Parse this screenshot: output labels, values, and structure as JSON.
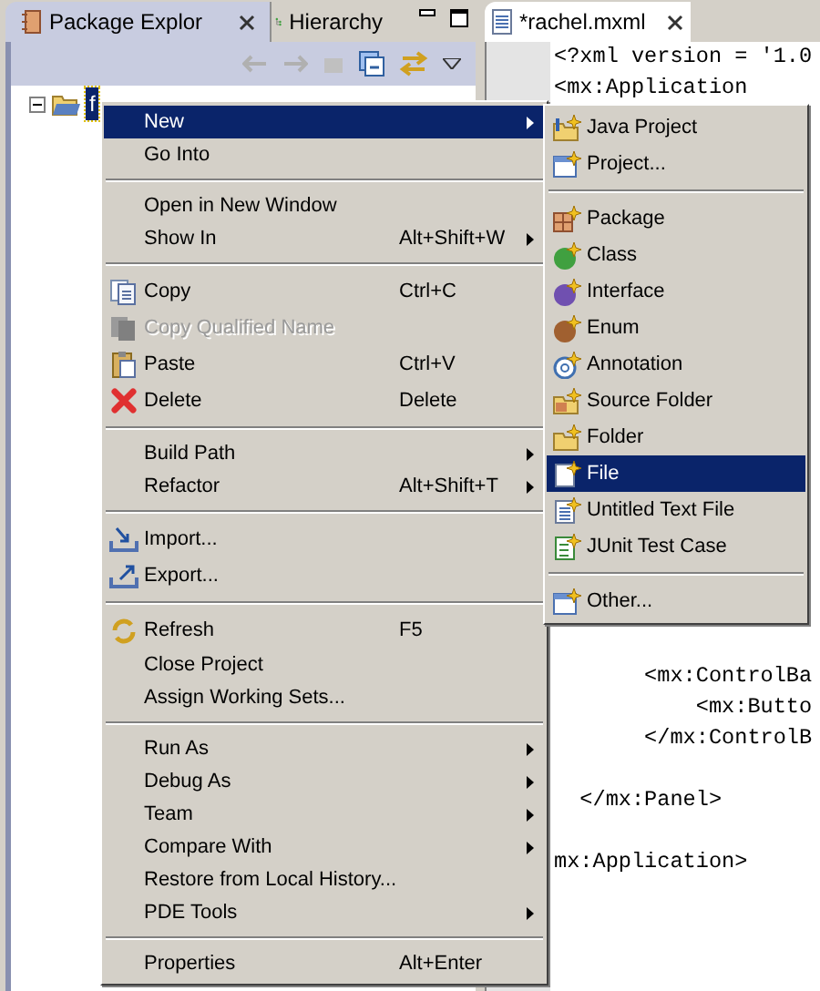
{
  "left_view": {
    "tabs": [
      {
        "label": "Package Explor",
        "selected": true
      },
      {
        "label": "Hierarchy",
        "selected": false
      }
    ],
    "tree": [
      {
        "label": "f",
        "expanded": true,
        "selected": true
      }
    ]
  },
  "editor": {
    "tab": {
      "label": "*rachel.mxml"
    },
    "lines": [
      {
        "kind": "code",
        "text": "<?xml version = '1.0"
      },
      {
        "kind": "code",
        "text": "<mx:Application"
      },
      {
        "kind": "blank"
      },
      {
        "kind": "blank"
      },
      {
        "kind": "blank"
      },
      {
        "kind": "blank"
      },
      {
        "kind": "blank"
      },
      {
        "kind": "blank"
      },
      {
        "kind": "blank"
      },
      {
        "kind": "blank"
      },
      {
        "kind": "blank"
      },
      {
        "kind": "blank"
      },
      {
        "kind": "blank"
      },
      {
        "kind": "blank"
      },
      {
        "kind": "blank"
      },
      {
        "kind": "blank"
      },
      {
        "kind": "blank"
      },
      {
        "kind": "blank"
      },
      {
        "kind": "blank"
      },
      {
        "kind": "blank"
      },
      {
        "kind": "code",
        "text": "       <mx:ControlBa"
      },
      {
        "kind": "code",
        "text": "           <mx:Butto"
      },
      {
        "kind": "code",
        "text": "       </mx:ControlB"
      },
      {
        "kind": "blank"
      },
      {
        "kind": "code",
        "text": "  </mx:Panel>"
      },
      {
        "kind": "blank"
      },
      {
        "kind": "code",
        "text": "mx:Application>"
      }
    ]
  },
  "context_menu": {
    "items": [
      {
        "kind": "item",
        "label": "New",
        "submenu": true,
        "selected": true,
        "disabled": false
      },
      {
        "kind": "item",
        "label": "Go Into",
        "selected": false,
        "disabled": false
      },
      {
        "kind": "separator"
      },
      {
        "kind": "item",
        "label": "Open in New Window",
        "selected": false,
        "disabled": false
      },
      {
        "kind": "item",
        "label": "Show In",
        "shortcut": "Alt+Shift+W",
        "submenu": true,
        "selected": false,
        "disabled": false
      },
      {
        "kind": "separator"
      },
      {
        "kind": "item",
        "label": "Copy",
        "shortcut": "Ctrl+C",
        "selected": false,
        "disabled": false
      },
      {
        "kind": "item",
        "label": "Copy Qualified Name",
        "selected": false,
        "disabled": true
      },
      {
        "kind": "item",
        "label": "Paste",
        "shortcut": "Ctrl+V",
        "selected": false,
        "disabled": false
      },
      {
        "kind": "item",
        "label": "Delete",
        "shortcut": "Delete",
        "selected": false,
        "disabled": false
      },
      {
        "kind": "separator"
      },
      {
        "kind": "item",
        "label": "Build Path",
        "submenu": true,
        "selected": false,
        "disabled": false
      },
      {
        "kind": "item",
        "label": "Refactor",
        "shortcut": "Alt+Shift+T",
        "submenu": true,
        "selected": false,
        "disabled": false
      },
      {
        "kind": "separator"
      },
      {
        "kind": "item",
        "label": "Import...",
        "selected": false,
        "disabled": false
      },
      {
        "kind": "item",
        "label": "Export...",
        "selected": false,
        "disabled": false
      },
      {
        "kind": "separator"
      },
      {
        "kind": "item",
        "label": "Refresh",
        "shortcut": "F5",
        "selected": false,
        "disabled": false
      },
      {
        "kind": "item",
        "label": "Close Project",
        "selected": false,
        "disabled": false
      },
      {
        "kind": "item",
        "label": "Assign Working Sets...",
        "selected": false,
        "disabled": false
      },
      {
        "kind": "separator"
      },
      {
        "kind": "item",
        "label": "Run As",
        "submenu": true,
        "selected": false,
        "disabled": false
      },
      {
        "kind": "item",
        "label": "Debug As",
        "submenu": true,
        "selected": false,
        "disabled": false
      },
      {
        "kind": "item",
        "label": "Team",
        "submenu": true,
        "selected": false,
        "disabled": false
      },
      {
        "kind": "item",
        "label": "Compare With",
        "submenu": true,
        "selected": false,
        "disabled": false
      },
      {
        "kind": "item",
        "label": "Restore from Local History...",
        "selected": false,
        "disabled": false
      },
      {
        "kind": "item",
        "label": "PDE Tools",
        "submenu": true,
        "selected": false,
        "disabled": false
      },
      {
        "kind": "separator"
      },
      {
        "kind": "item",
        "label": "Properties",
        "shortcut": "Alt+Enter",
        "selected": false,
        "disabled": false
      }
    ]
  },
  "new_submenu": {
    "items": [
      {
        "kind": "item",
        "label": "Java Project",
        "selected": false
      },
      {
        "kind": "item",
        "label": "Project...",
        "selected": false
      },
      {
        "kind": "separator"
      },
      {
        "kind": "item",
        "label": "Package",
        "selected": false
      },
      {
        "kind": "item",
        "label": "Class",
        "selected": false
      },
      {
        "kind": "item",
        "label": "Interface",
        "selected": false
      },
      {
        "kind": "item",
        "label": "Enum",
        "selected": false
      },
      {
        "kind": "item",
        "label": "Annotation",
        "selected": false
      },
      {
        "kind": "item",
        "label": "Source Folder",
        "selected": false
      },
      {
        "kind": "item",
        "label": "Folder",
        "selected": false
      },
      {
        "kind": "item",
        "label": "File",
        "selected": true
      },
      {
        "kind": "item",
        "label": "Untitled Text File",
        "selected": false
      },
      {
        "kind": "item",
        "label": "JUnit Test Case",
        "selected": false
      },
      {
        "kind": "separator"
      },
      {
        "kind": "item",
        "label": "Other...",
        "selected": false
      }
    ]
  }
}
